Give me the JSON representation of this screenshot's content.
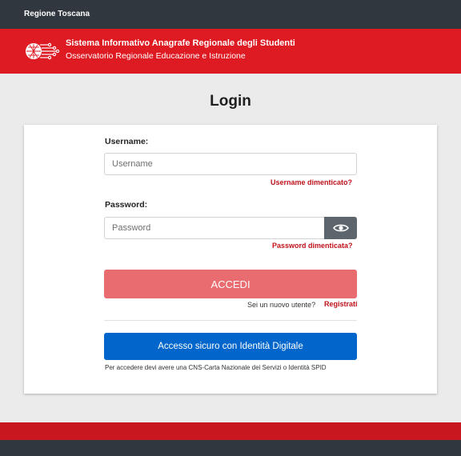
{
  "topbar": {
    "region": "Regione Toscana"
  },
  "header": {
    "title": "Sistema Informativo Anagrafe Regionale degli Studenti",
    "subtitle": "Osservatorio Regionale Educazione e Istruzione"
  },
  "login": {
    "title": "Login",
    "username_label": "Username:",
    "username_placeholder": "Username",
    "username_value": "",
    "forgot_username": "Username dimenticato?",
    "password_label": "Password:",
    "password_placeholder": "Password",
    "password_value": "",
    "forgot_password": "Password dimenticata?",
    "submit_label": "ACCEDI",
    "new_user_text": "Sei un nuovo utente?",
    "register_link": "Registrati",
    "spid_button": "Accesso sicuro con Identità Digitale",
    "spid_note": "Per accedere devi avere una CNS-Carta Nazionale dei Servizi o Identità SPID"
  },
  "colors": {
    "topbar": "#30373e",
    "header_red": "#de1a22",
    "accedi_button": "#e86c70",
    "spid_button": "#0066cc",
    "link_red": "#c1121a"
  },
  "icons": {
    "logo": "circuit-network-logo",
    "password_toggle": "eye-icon"
  }
}
